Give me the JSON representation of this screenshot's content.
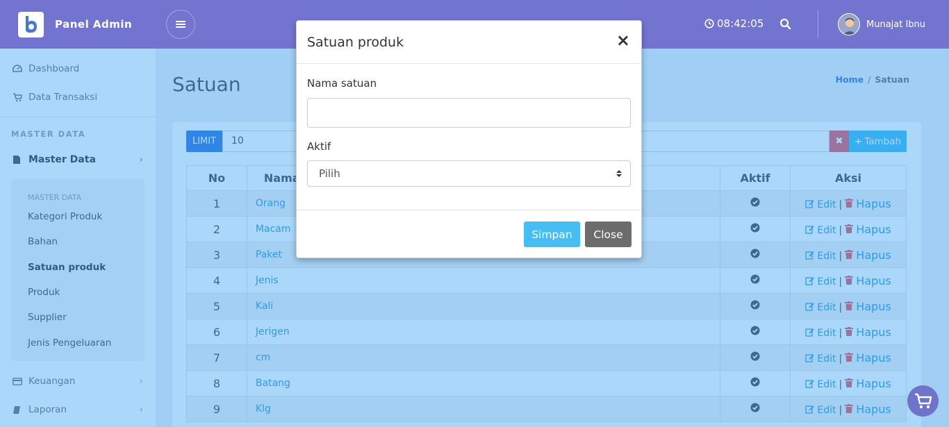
{
  "topbar": {
    "brand": "Panel Admin",
    "time": "08:42:05",
    "user_name": "Munajat Ibnu"
  },
  "sidebar": {
    "items": [
      {
        "label": "Dashboard",
        "icon": "dashboard-icon"
      },
      {
        "label": "Data Transaksi",
        "icon": "cart-icon"
      }
    ],
    "section_label": "MASTER DATA",
    "master": {
      "label": "Master Data",
      "icon": "file-icon"
    },
    "sub_head": "MASTER DATA",
    "sub_items": [
      "Kategori Produk",
      "Bahan",
      "Satuan produk",
      "Produk",
      "Supplier",
      "Jenis Pengeluaran"
    ],
    "active_sub": "Satuan produk",
    "keuangan": {
      "label": "Keuangan",
      "icon": "credit-card-icon"
    },
    "laporan": {
      "label": "Laporan",
      "icon": "book-icon"
    }
  },
  "page": {
    "title": "Satuan",
    "breadcrumb": {
      "home": "Home",
      "sep": "/",
      "current": "Satuan"
    }
  },
  "toolbar": {
    "limit_label": "LIMIT",
    "limit_value": "10",
    "clear_label": "✖",
    "add_label": "Tambah"
  },
  "table": {
    "headers": {
      "no": "No",
      "nama": "Nama",
      "aktif": "Aktif",
      "aksi": "Aksi"
    },
    "edit_label": "Edit",
    "pipe": "|",
    "delete_label": "Hapus",
    "rows": [
      {
        "no": "1",
        "nama": "Orang"
      },
      {
        "no": "2",
        "nama": "Macam"
      },
      {
        "no": "3",
        "nama": "Paket"
      },
      {
        "no": "4",
        "nama": "Jenis"
      },
      {
        "no": "5",
        "nama": "Kali"
      },
      {
        "no": "6",
        "nama": "Jerigen"
      },
      {
        "no": "7",
        "nama": "cm"
      },
      {
        "no": "8",
        "nama": "Batang"
      },
      {
        "no": "9",
        "nama": "Klg"
      }
    ]
  },
  "modal": {
    "title": "Satuan produk",
    "close_symbol": "×",
    "name_label": "Nama satuan",
    "name_value": "",
    "aktif_label": "Aktif",
    "aktif_selected": "Pilih",
    "save_label": "Simpan",
    "close_label": "Close"
  },
  "colors": {
    "primary": "#3b7ddd",
    "info": "#47bef2",
    "overlay": "#2196f3",
    "topbar": "#7171ce"
  }
}
